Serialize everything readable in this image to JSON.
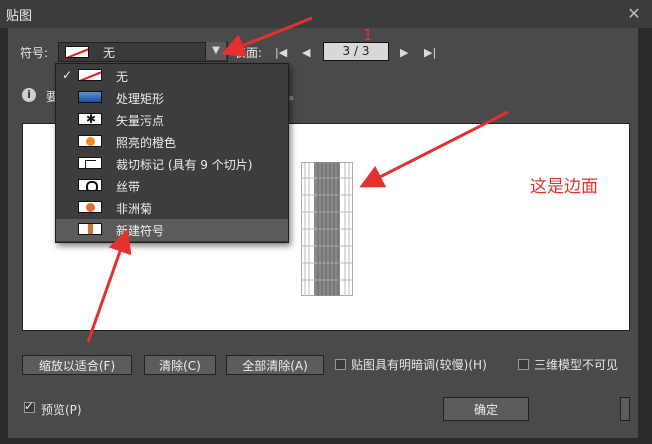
{
  "window": {
    "title": "贴图"
  },
  "toolbar": {
    "symbol_label": "符号:",
    "symbol_value": "无",
    "surface_label": "表面:",
    "page_value": "3 / 3"
  },
  "info_text": "要",
  "dropdown": {
    "items": [
      {
        "label": "无",
        "checked": true,
        "icon": "none-swatch-icon"
      },
      {
        "label": "处理矩形",
        "icon": "blue-rectangle-icon"
      },
      {
        "label": "矢量污点",
        "icon": "splat-icon"
      },
      {
        "label": "照亮的橙色",
        "icon": "orange-icon"
      },
      {
        "label": "裁切标记 (具有 9 个切片)",
        "icon": "crop-marks-icon"
      },
      {
        "label": "丝带",
        "icon": "ribbon-icon"
      },
      {
        "label": "非洲菊",
        "icon": "gerbera-icon"
      },
      {
        "label": "新建符号",
        "icon": "new-symbol-icon",
        "highlighted": true
      }
    ]
  },
  "annotations": {
    "edge_label": "这是边面",
    "number_mark": "1"
  },
  "buttons": {
    "scale_fit": "缩放以适合(F)",
    "clear": "清除(C)",
    "clear_all": "全部清除(A)",
    "ok": "确定"
  },
  "checkboxes": {
    "shade": "贴图具有明暗调(较慢)(H)",
    "invisible": "三维模型不可见",
    "preview": "预览(P)"
  },
  "colors": {
    "annotation": "#e53030",
    "panel": "#4a4a4a"
  }
}
